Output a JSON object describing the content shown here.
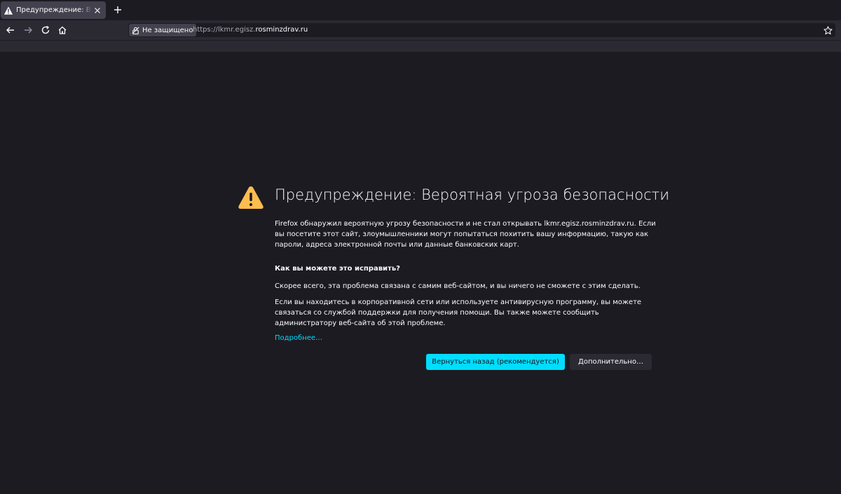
{
  "browser": {
    "tab": {
      "title": "Предупреждение: Вероятная угроза безопасности"
    },
    "urlbar": {
      "identity_label": "Не защищено",
      "url_prefix": "https://",
      "url_subdomain": "lkmr.egisz.",
      "url_host": "rosminzdrav.ru"
    }
  },
  "page": {
    "title": "Предупреждение: Вероятная угроза безопасности",
    "intro": "Firefox обнаружил вероятную угрозу безопасности и не стал открывать lkmr.egisz.rosminzdrav.ru. Если вы посетите этот сайт, злоумышленники могут попытаться похитить вашу информацию, такую как пароли, адреса электронной почты или данные банковских карт.",
    "fix_heading": "Как вы можете это исправить?",
    "fix_text_1": "Скорее всего, эта проблема связана с самим веб-сайтом, и вы ничего не сможете с этим сделать.",
    "fix_text_2": "Если вы находитесь в корпоративной сети или используете антивирусную программу, вы можете связаться со службой поддержки для получения помощи. Вы также можете сообщить администратору веб-сайта об этой проблеме.",
    "learn_more": "Подробнее…",
    "go_back_button": "Вернуться назад (рекомендуется)",
    "advanced_button": "Дополнительно…"
  },
  "colors": {
    "background": "#1c1b22",
    "toolbar": "#2b2a33",
    "accent": "#00ddff",
    "warning": "#ffbd4f"
  }
}
